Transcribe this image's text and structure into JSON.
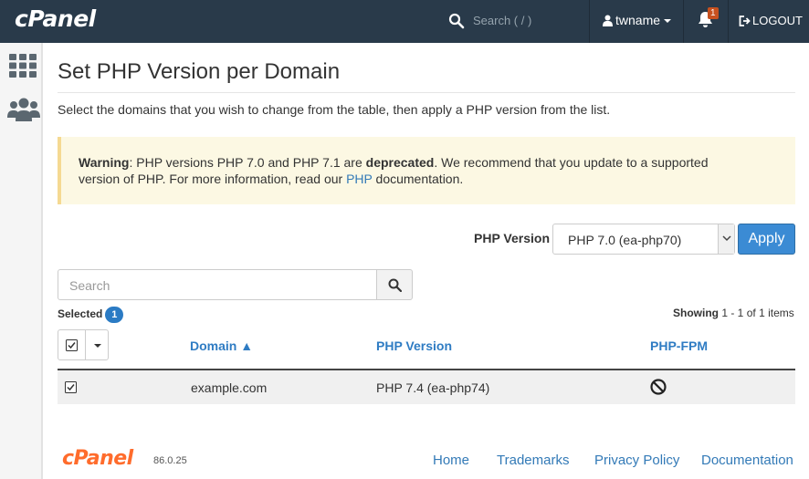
{
  "header": {
    "logo": "cPanel",
    "search_placeholder": "Search ( / )",
    "username": "twname",
    "notification_count": "1",
    "logout_label": "LOGOUT"
  },
  "page": {
    "title": "Set PHP Version per Domain",
    "intro": "Select the domains that you wish to change from the table, then apply a PHP version from the list."
  },
  "warning": {
    "label": "Warning",
    "text_1": ": PHP versions PHP 7.0 and PHP 7.1 are ",
    "bold": "deprecated",
    "text_2": ". We recommend that you update to a supported",
    "text_3": "version of PHP. For more information, read our ",
    "link": "PHP",
    "text_4": " documentation."
  },
  "php_selector": {
    "label": "PHP Version",
    "selected": "PHP 7.0 (ea-php70)",
    "apply_label": "Apply"
  },
  "table_search": {
    "placeholder": "Search"
  },
  "selection": {
    "label": "Selected",
    "count": "1"
  },
  "showing": {
    "label": "Showing",
    "range": "1 - 1",
    "of": "of",
    "total": "1",
    "unit": "items"
  },
  "table": {
    "columns": [
      "Domain ▲",
      "PHP Version",
      "PHP-FPM"
    ],
    "rows": [
      {
        "domain": "example.com",
        "php_version": "PHP 7.4 (ea-php74)",
        "php_fpm": "disabled",
        "checked": true
      }
    ]
  },
  "footer": {
    "logo": "cPanel",
    "version": "86.0.25",
    "links": [
      "Home",
      "Trademarks",
      "Privacy Policy",
      "Documentation"
    ]
  },
  "colors": {
    "topbar": "#293a4a",
    "accent": "#337ab7",
    "apply_button": "#3b8bd4",
    "warning_bg": "#fcf8e3",
    "brand_orange": "#ff6c2c"
  },
  "icons": {
    "sidebar": [
      "grid-icon",
      "users-icon"
    ],
    "header": [
      "search-icon",
      "user-icon",
      "bell-icon",
      "logout-icon"
    ]
  }
}
